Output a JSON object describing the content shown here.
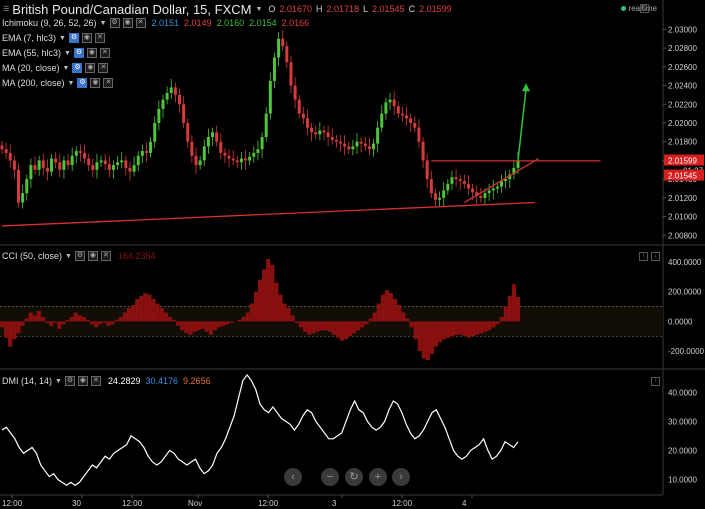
{
  "header": {
    "symbol": "British Pound/Canadian Dollar, 15, FXCM",
    "ohlc": [
      {
        "k": "O",
        "v": "2.01670"
      },
      {
        "k": "H",
        "v": "2.01718"
      },
      {
        "k": "L",
        "v": "2.01545"
      },
      {
        "k": "C",
        "v": "2.01599"
      }
    ],
    "realtime": "realtime"
  },
  "indicators": {
    "ichimoku": {
      "label": "Ichimoku (9, 26, 52, 26)",
      "values": [
        "2.0151",
        "2.0149",
        "2.0160",
        "2.0154",
        "2.0166"
      ],
      "colors": [
        "#2e8fe0",
        "#e04040",
        "#3cc03c",
        "#3cc03c",
        "#e04040"
      ]
    },
    "ema7": {
      "label": "EMA (7, hlc3)"
    },
    "ema55": {
      "label": "EMA (55, hlc3)"
    },
    "ma20": {
      "label": "MA (20, close)"
    },
    "ma200": {
      "label": "MA (200, close)"
    }
  },
  "cci_panel": {
    "label": "CCI (50, close)",
    "value": "164.2354"
  },
  "dmi_panel": {
    "label": "DMI (14, 14)",
    "values": [
      {
        "v": "24.2829",
        "color": "#ffffff"
      },
      {
        "v": "30.4176",
        "color": "#3a8de0"
      },
      {
        "v": "9.2656",
        "color": "#e07030"
      }
    ]
  },
  "price_axis": {
    "labels": [
      "2.03000",
      "2.02800",
      "2.02600",
      "2.02400",
      "2.02200",
      "2.02000",
      "2.01800",
      "2.01600",
      "2.01400",
      "2.01200",
      "2.01000",
      "2.00800"
    ],
    "current_price": "2.01599",
    "countdown": "01:37",
    "low_price": "2.01545"
  },
  "cci_axis": {
    "labels": [
      "400.0000",
      "200.0000",
      "0.0000",
      "-200.0000"
    ]
  },
  "dmi_axis": {
    "labels": [
      "40.0000",
      "30.0000",
      "20.0000",
      "10.0000"
    ]
  },
  "time_axis": {
    "labels": [
      "12:00",
      "30",
      "12:00",
      "Nov",
      "12:00",
      "3",
      "12:00",
      "4"
    ]
  },
  "nav_buttons": [
    "‹",
    "−",
    "↻",
    "+",
    "›"
  ],
  "colors": {
    "up": "#4fc53a",
    "down": "#d63b3b",
    "trend": "#d63030",
    "signal": "#34c23a",
    "cci_fill": "#8a1010"
  },
  "chart_data": [
    {
      "type": "candlestick",
      "title": "British Pound/Canadian Dollar, 15, FXCM",
      "ylim": [
        2.0075,
        2.031
      ],
      "series": [
        {
          "name": "",
          "close": [
            2.0172,
            2.0168,
            2.016,
            2.015,
            2.0115,
            2.0125,
            2.014,
            2.0155,
            2.015,
            2.016,
            2.0152,
            2.0148,
            2.0162,
            2.0158,
            2.015,
            2.016,
            2.0155,
            2.0165,
            2.017,
            2.0168,
            2.0162,
            2.0155,
            2.015,
            2.0158,
            2.016,
            2.0156,
            2.015,
            2.0155,
            2.0158,
            2.016,
            2.0152,
            2.0148,
            2.0155,
            2.0165,
            2.017,
            2.0168,
            2.018,
            2.02,
            2.0215,
            2.0225,
            2.0232,
            2.0238,
            2.023,
            2.022,
            2.02,
            2.018,
            2.0165,
            2.0155,
            2.016,
            2.0175,
            2.0185,
            2.019,
            2.018,
            2.0168,
            2.0165,
            2.0162,
            2.016,
            2.0158,
            2.0162,
            2.016,
            2.0164,
            2.0168,
            2.0172,
            2.0185,
            2.021,
            2.0245,
            2.027,
            2.029,
            2.0282,
            2.0265,
            2.024,
            2.0225,
            2.021,
            2.0205,
            2.0195,
            2.019,
            2.0188,
            2.0192,
            2.019,
            2.0185,
            2.0182,
            2.018,
            2.0178,
            2.0175,
            2.0172,
            2.0175,
            2.018,
            2.0178,
            2.0175,
            2.0172,
            2.0178,
            2.0195,
            2.021,
            2.0222,
            2.0225,
            2.0218,
            2.021,
            2.0208,
            2.0205,
            2.02,
            2.0195,
            2.018,
            2.016,
            2.014,
            2.0125,
            2.0118,
            2.012,
            2.0128,
            2.0135,
            2.0142,
            2.014,
            2.0138,
            2.0135,
            2.013,
            2.0126,
            2.0122,
            2.012,
            2.0125,
            2.0128,
            2.013,
            2.0132,
            2.0138,
            2.014,
            2.0145,
            2.0152,
            2.016
          ]
        }
      ],
      "trendlines": [
        {
          "from": [
            0,
            2.009
          ],
          "to": [
            129,
            2.0115
          ]
        },
        {
          "from": [
            104,
            2.01595
          ],
          "to": [
            145,
            2.01595
          ]
        },
        {
          "from": [
            112,
            2.0115
          ],
          "to": [
            130,
            2.0162
          ]
        }
      ]
    },
    {
      "type": "bar",
      "title": "CCI (50, close)",
      "ylim": [
        -300,
        480
      ],
      "bands": [
        100,
        -100
      ],
      "values": [
        -40,
        -110,
        -170,
        -120,
        -80,
        -30,
        20,
        60,
        40,
        70,
        30,
        -10,
        -30,
        -10,
        -50,
        -20,
        10,
        30,
        60,
        40,
        30,
        10,
        -20,
        -40,
        -20,
        -10,
        -30,
        -20,
        10,
        30,
        60,
        90,
        110,
        150,
        170,
        190,
        180,
        150,
        120,
        90,
        60,
        30,
        10,
        -30,
        -60,
        -80,
        -90,
        -70,
        -60,
        -50,
        -70,
        -90,
        -60,
        -40,
        -30,
        -20,
        -10,
        0,
        10,
        30,
        60,
        120,
        200,
        280,
        350,
        420,
        380,
        260,
        180,
        120,
        90,
        40,
        -10,
        -40,
        -70,
        -90,
        -80,
        -70,
        -60,
        -60,
        -70,
        -90,
        -110,
        -130,
        -120,
        -100,
        -80,
        -60,
        -40,
        -20,
        20,
        60,
        120,
        180,
        210,
        190,
        150,
        110,
        60,
        20,
        -40,
        -120,
        -200,
        -250,
        -260,
        -220,
        -170,
        -140,
        -120,
        -110,
        -100,
        -90,
        -90,
        -100,
        -110,
        -100,
        -90,
        -80,
        -70,
        -60,
        -40,
        -20,
        30,
        100,
        170,
        250,
        164
      ]
    },
    {
      "type": "line",
      "title": "DMI (14, 14)",
      "ylim": [
        5,
        47
      ],
      "series": [
        {
          "name": "",
          "values": [
            27,
            28,
            26,
            24,
            21,
            19,
            20,
            21,
            19,
            15,
            13,
            11,
            12,
            10,
            9,
            8,
            9,
            8,
            9,
            11,
            13,
            15,
            14,
            16,
            18,
            17,
            19,
            20,
            21,
            22,
            25,
            24,
            23,
            21,
            18,
            16,
            15,
            16,
            18,
            20,
            19,
            17,
            16,
            15,
            16,
            17,
            14,
            12,
            13,
            15,
            19,
            21,
            24,
            28,
            32,
            38,
            44,
            46,
            44,
            41,
            36,
            34,
            33,
            35,
            33,
            31,
            30,
            29,
            27,
            29,
            32,
            34,
            33,
            30,
            28,
            26,
            24,
            24,
            25,
            26,
            30,
            34,
            37,
            34,
            33,
            30,
            28,
            27,
            28,
            30,
            34,
            37,
            36,
            33,
            29,
            26,
            24,
            25,
            27,
            30,
            33,
            34,
            31,
            28,
            24,
            20,
            18,
            17,
            18,
            20,
            21,
            22,
            24,
            20,
            17,
            18,
            20,
            23,
            22,
            21,
            23
          ]
        }
      ]
    }
  ]
}
